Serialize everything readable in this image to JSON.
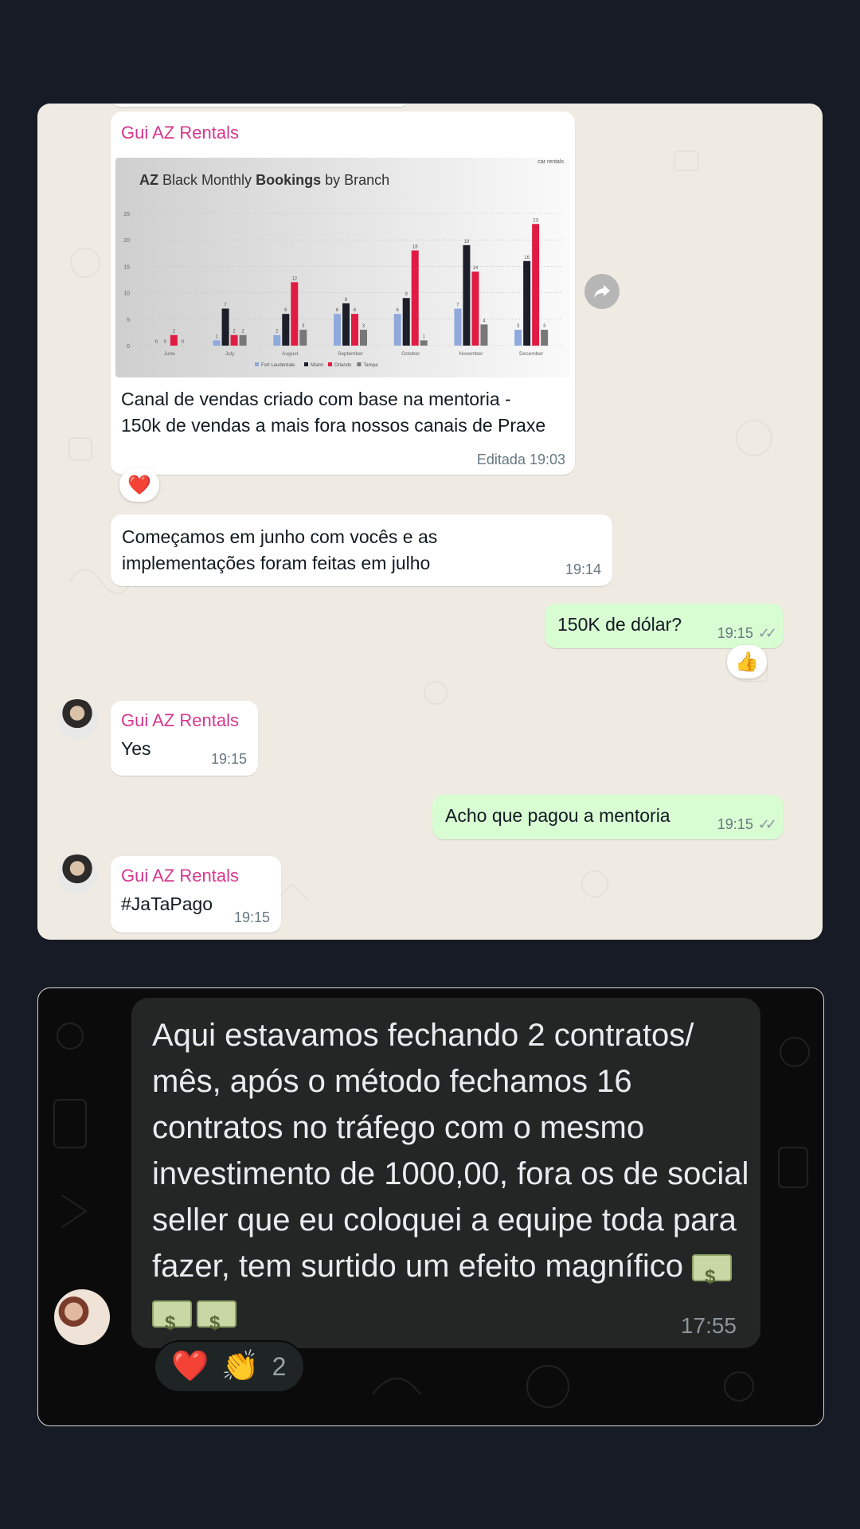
{
  "panel1": {
    "chart_message": {
      "sender": "Gui AZ Rentals",
      "text": "Canal de vendas criado com base na mentoria - 150k de vendas a mais fora nossos canais de Praxe",
      "time": "Editada 19:03",
      "reaction": "❤️"
    },
    "msg2": {
      "text": "Começamos em junho com vocês e as implementações foram feitas em julho",
      "time": "19:14"
    },
    "msg3": {
      "text": "150K de dólar?",
      "time": "19:15",
      "reaction": "👍"
    },
    "msg4": {
      "sender": "Gui AZ Rentals",
      "text": "Yes",
      "time": "19:15"
    },
    "msg5": {
      "text": "Acho que pagou a mentoria",
      "time": "19:15"
    },
    "msg6": {
      "sender": "Gui AZ Rentals",
      "text": "#JaTaPago",
      "time": "19:15"
    }
  },
  "chart_data": {
    "type": "bar",
    "title_prefix": "AZ",
    "title_mid": "Black Monthly",
    "title_bold": "Bookings",
    "title_suffix": "by Branch",
    "corner_label": "car rentals",
    "categories": [
      "June",
      "July",
      "August",
      "September",
      "October",
      "November",
      "December"
    ],
    "ylim": [
      0,
      25
    ],
    "yticks": [
      0,
      5,
      10,
      15,
      20,
      25
    ],
    "series": [
      {
        "name": "Fort Lauderdale",
        "color": "#8fa9dc",
        "values": [
          0,
          1,
          2,
          6,
          6,
          7,
          3
        ]
      },
      {
        "name": "Miami",
        "color": "#1c1f2a",
        "values": [
          0,
          7,
          6,
          8,
          9,
          19,
          16
        ]
      },
      {
        "name": "Orlando",
        "color": "#e01c44",
        "values": [
          2,
          2,
          12,
          6,
          18,
          14,
          23
        ]
      },
      {
        "name": "Tampa",
        "color": "#777777",
        "values": [
          0,
          2,
          3,
          3,
          1,
          4,
          3
        ]
      }
    ],
    "legend_position": "bottom"
  },
  "panel2": {
    "text": "Aqui estavamos fechando 2 contratos/ mês, após o método fechamos 16 contratos no tráfego com o mesmo investimento de 1000,00, fora os de social seller que eu coloquei a equipe toda para fazer, tem surtido um efeito magnífico",
    "time": "17:55",
    "reaction_1": "❤️",
    "reaction_2": "👏",
    "reaction_count": "2",
    "emoji_icon": "money-bag-icon"
  }
}
